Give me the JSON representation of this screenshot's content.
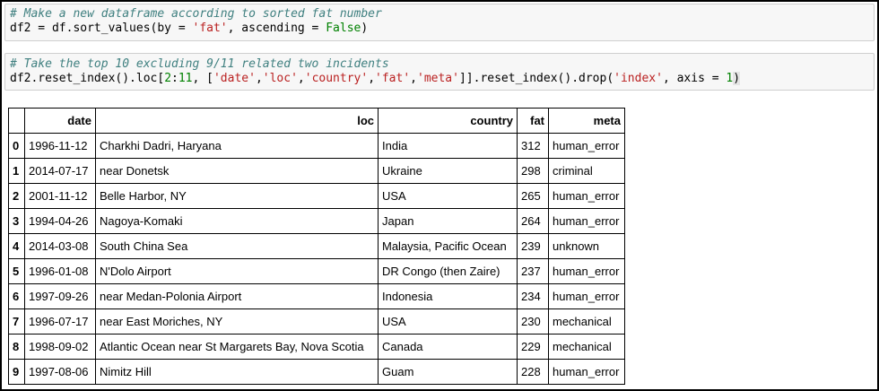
{
  "cell1": {
    "comment": "# Make a new dataframe according to sorted fat number",
    "code": {
      "p1": "df2 = df.sort_values(by = ",
      "s1": "'fat'",
      "p2": ", ascending = ",
      "kw": "False",
      "p3": ")"
    }
  },
  "cell2": {
    "comment": "# Take the top 10 excluding 9/11 related two incidents",
    "code": {
      "p1": "df2.reset_index().loc[",
      "n1": "2",
      "p2": ":",
      "n2": "11",
      "p3": ", [",
      "s1": "'date'",
      "c1": ",",
      "s2": "'loc'",
      "c2": ",",
      "s3": "'country'",
      "c3": ",",
      "s4": "'fat'",
      "c4": ",",
      "s5": "'meta'",
      "p4": "]].reset_index().drop(",
      "s6": "'index'",
      "p5": ", axis = ",
      "n3": "1",
      "p6": ")"
    }
  },
  "table": {
    "headers": [
      "",
      "date",
      "loc",
      "country",
      "fat",
      "meta"
    ],
    "rows": [
      {
        "idx": "0",
        "date": "1996-11-12",
        "loc": "Charkhi Dadri, Haryana",
        "country": "India",
        "fat": "312",
        "meta": "human_error"
      },
      {
        "idx": "1",
        "date": "2014-07-17",
        "loc": "near Donetsk",
        "country": "Ukraine",
        "fat": "298",
        "meta": "criminal"
      },
      {
        "idx": "2",
        "date": "2001-11-12",
        "loc": "Belle Harbor, NY",
        "country": "USA",
        "fat": "265",
        "meta": "human_error"
      },
      {
        "idx": "3",
        "date": "1994-04-26",
        "loc": "Nagoya-Komaki",
        "country": "Japan",
        "fat": "264",
        "meta": "human_error"
      },
      {
        "idx": "4",
        "date": "2014-03-08",
        "loc": "South China Sea",
        "country": "Malaysia, Pacific Ocean",
        "fat": "239",
        "meta": "unknown"
      },
      {
        "idx": "5",
        "date": "1996-01-08",
        "loc": "N'Dolo Airport",
        "country": "DR Congo (then Zaire)",
        "fat": "237",
        "meta": "human_error"
      },
      {
        "idx": "6",
        "date": "1997-09-26",
        "loc": "near Medan-Polonia Airport",
        "country": "Indonesia",
        "fat": "234",
        "meta": "human_error"
      },
      {
        "idx": "7",
        "date": "1996-07-17",
        "loc": "near East Moriches, NY",
        "country": "USA",
        "fat": "230",
        "meta": "mechanical"
      },
      {
        "idx": "8",
        "date": "1998-09-02",
        "loc": "Atlantic Ocean near St Margarets Bay, Nova Scotia",
        "country": "Canada",
        "fat": "229",
        "meta": "mechanical"
      },
      {
        "idx": "9",
        "date": "1997-08-06",
        "loc": "Nimitz Hill",
        "country": "Guam",
        "fat": "228",
        "meta": "human_error"
      }
    ]
  }
}
